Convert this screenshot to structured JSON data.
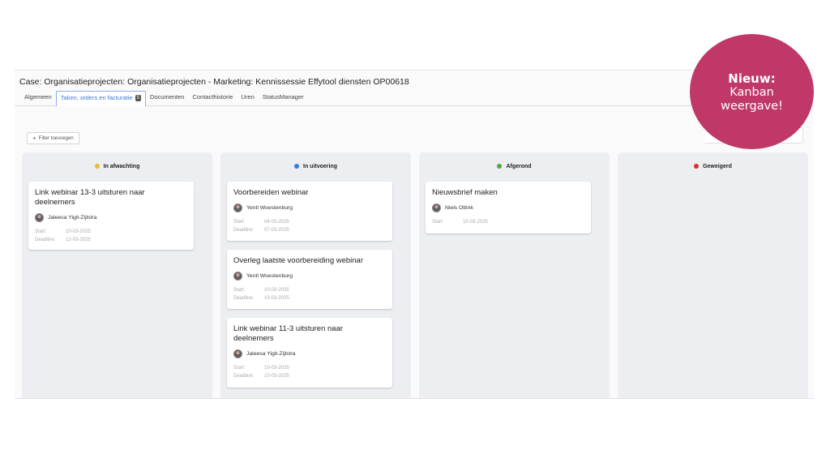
{
  "case": {
    "title": "Case: Organisatieprojecten: Organisatieprojecten - Marketing: Kennissessie Effytool diensten OP00618"
  },
  "tabs": [
    {
      "label": "Algemeen"
    },
    {
      "label": "Taken, orders en facturatie",
      "badge": "5",
      "active": true
    },
    {
      "label": "Documenten"
    },
    {
      "label": "Contacthistorie"
    },
    {
      "label": "Uren"
    },
    {
      "label": "StatusManager"
    }
  ],
  "toolbar": {
    "filter_label": "Filter toevoegen",
    "filter_icon": "plus-icon"
  },
  "date_labels": {
    "start": "Start:",
    "deadline": "Deadline:"
  },
  "columns": [
    {
      "title": "In afwachting",
      "color": "#f2b630",
      "cards": [
        {
          "title": "Link webinar 13-3 uitsturen naar deelnemers",
          "assignee": "Jaleesa Yigit-Zijlstra",
          "start": "10-03-2025",
          "deadline": "12-03-2025"
        }
      ]
    },
    {
      "title": "In uitvoering",
      "color": "#2f7fe0",
      "cards": [
        {
          "title": "Voorbereiden webinar",
          "assignee": "Yentl Woestenburg",
          "start": "04-03-2025",
          "deadline": "07-03-2025"
        },
        {
          "title": "Overleg laatste voorbereiding webinar",
          "assignee": "Yentl Woestenburg",
          "start": "10-03-2025",
          "deadline": "10-03-2025"
        },
        {
          "title": "Link webinar 11-3 uitsturen naar deelnemers",
          "assignee": "Jaleesa Yigit-Zijlstra",
          "start": "10-03-2025",
          "deadline": "10-03-2025"
        }
      ]
    },
    {
      "title": "Afgerond",
      "color": "#4aab3c",
      "cards": [
        {
          "title": "Nieuwsbrief maken",
          "assignee": "Niels Ottink",
          "start": "10-03-2025"
        }
      ]
    },
    {
      "title": "Geweigerd",
      "color": "#d93030",
      "cards": []
    }
  ],
  "promo": {
    "line1": "Nieuw:",
    "line2": "Kanban",
    "line3": "weergave!",
    "color": "#c03868"
  }
}
